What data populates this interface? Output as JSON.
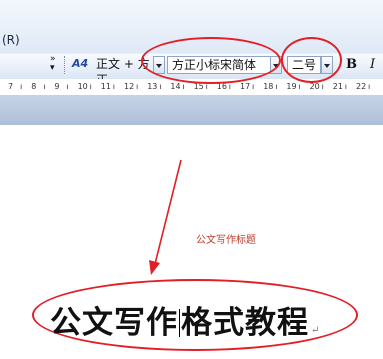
{
  "menu": {
    "partial_item": "(R)"
  },
  "toolbar": {
    "style_icon_label": "A4",
    "style_value": "正文 + 方正",
    "font_value": "方正小标宋简体",
    "size_value": "二号",
    "bold_label": "B",
    "italic_label": "I"
  },
  "ruler": {
    "ticks": [
      "7",
      "8",
      "9",
      "10",
      "11",
      "12",
      "13",
      "14",
      "15",
      "16",
      "17",
      "18",
      "19",
      "20",
      "21",
      "22"
    ]
  },
  "annotation": {
    "caption": "公文写作标题",
    "highlight_color": "#e21f26"
  },
  "document": {
    "heading_before_cursor": "公文写作",
    "heading_after_cursor": "格式教程",
    "paragraph_mark": "↵"
  }
}
